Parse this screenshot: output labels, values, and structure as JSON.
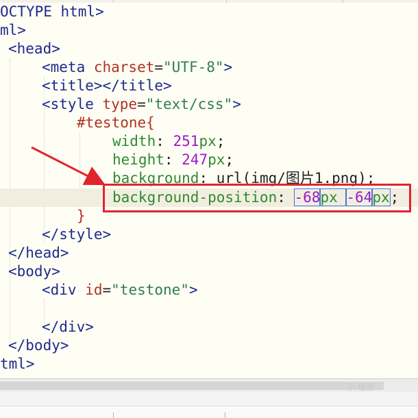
{
  "editor": {
    "lines": [
      {
        "parts": [
          {
            "t": "OCTYPE html>",
            "c": "t"
          }
        ]
      },
      {
        "parts": [
          {
            "t": "ml>",
            "c": "t"
          }
        ]
      },
      {
        "parts": [
          {
            "t": "<head>",
            "c": "t"
          }
        ]
      },
      {
        "parts": [
          {
            "t": "<meta ",
            "c": "t"
          },
          {
            "t": "charset",
            "c": "a"
          },
          {
            "t": "=",
            "c": ""
          },
          {
            "t": "\"UTF-8\"",
            "c": "s"
          },
          {
            "t": ">",
            "c": "t"
          }
        ]
      },
      {
        "parts": [
          {
            "t": "<title></title>",
            "c": "t"
          }
        ]
      },
      {
        "parts": [
          {
            "t": "<style ",
            "c": "t"
          },
          {
            "t": "type",
            "c": "a"
          },
          {
            "t": "=",
            "c": ""
          },
          {
            "t": "\"text/css\"",
            "c": "s"
          },
          {
            "t": ">",
            "c": "t"
          }
        ]
      },
      {
        "parts": [
          {
            "t": "#testone{",
            "c": "a"
          }
        ]
      },
      {
        "parts": [
          {
            "t": "width",
            "c": "u"
          },
          {
            "t": ": ",
            "c": ""
          },
          {
            "t": "251",
            "c": "n"
          },
          {
            "t": "px",
            "c": "u"
          },
          {
            "t": ";",
            "c": ""
          }
        ]
      },
      {
        "parts": [
          {
            "t": "height",
            "c": "u"
          },
          {
            "t": ": ",
            "c": ""
          },
          {
            "t": "247",
            "c": "n"
          },
          {
            "t": "px",
            "c": "u"
          },
          {
            "t": ";",
            "c": ""
          }
        ]
      },
      {
        "parts": [
          {
            "t": "background",
            "c": "u"
          },
          {
            "t": ": url(img/图片1.png);",
            "c": ""
          }
        ]
      },
      {
        "parts": [
          {
            "t": "background-position",
            "c": "u"
          },
          {
            "t": ": ",
            "c": ""
          },
          {
            "t": "-68",
            "c": "n",
            "sel": true
          },
          {
            "t": "px ",
            "c": "u",
            "sel": true
          },
          {
            "t": "-64",
            "c": "n",
            "sel": true
          },
          {
            "t": "px",
            "c": "u",
            "sel": true
          },
          {
            "t": ";",
            "c": "",
            "cursor": true
          }
        ]
      },
      {
        "parts": [
          {
            "t": "}",
            "c": "a"
          }
        ]
      },
      {
        "parts": [
          {
            "t": "</style>",
            "c": "t"
          }
        ]
      },
      {
        "parts": [
          {
            "t": "</head>",
            "c": "t"
          }
        ]
      },
      {
        "parts": [
          {
            "t": "<body>",
            "c": "t"
          }
        ]
      },
      {
        "parts": [
          {
            "t": "<div ",
            "c": "t"
          },
          {
            "t": "id",
            "c": "a"
          },
          {
            "t": "=",
            "c": ""
          },
          {
            "t": "\"testone\"",
            "c": "s"
          },
          {
            "t": ">",
            "c": "t"
          }
        ]
      },
      {
        "parts": []
      },
      {
        "parts": [
          {
            "t": "</div>",
            "c": "t"
          }
        ]
      },
      {
        "parts": [
          {
            "t": "</body>",
            "c": "t"
          }
        ]
      },
      {
        "parts": [
          {
            "t": "tml>",
            "c": "t"
          }
        ]
      }
    ]
  },
  "watermark": "小 经验"
}
